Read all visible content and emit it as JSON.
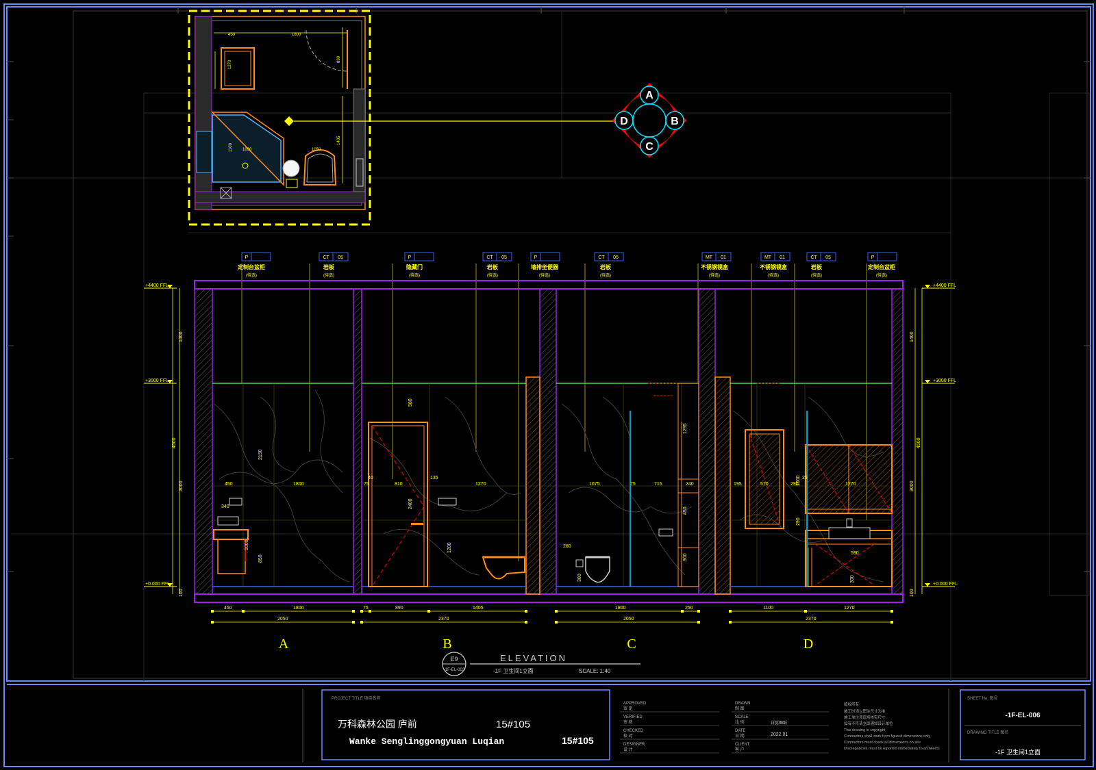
{
  "plan": {
    "dims": [
      "450",
      "1800",
      "1270",
      "890",
      "1100",
      "1000",
      "1050",
      "1405"
    ],
    "index_marks": [
      "A",
      "B",
      "C",
      "D"
    ]
  },
  "tags": [
    {
      "code": "P",
      "num": "",
      "label": "定制台盆柜",
      "sub": "(待选)"
    },
    {
      "code": "CT",
      "num": "05",
      "label": "岩板",
      "sub": "(待选)"
    },
    {
      "code": "P",
      "num": "",
      "label": "隐藏门",
      "sub": "(待选)"
    },
    {
      "code": "CT",
      "num": "05",
      "label": "岩板",
      "sub": "(待选)"
    },
    {
      "code": "P",
      "num": "",
      "label": "墙排坐便器",
      "sub": "(待选)"
    },
    {
      "code": "CT",
      "num": "05",
      "label": "岩板",
      "sub": "(待选)"
    },
    {
      "code": "MT",
      "num": "01",
      "label": "不锈钢镜盒",
      "sub": "(待选)"
    },
    {
      "code": "MT",
      "num": "01",
      "label": "不锈钢镜盒",
      "sub": "(待选)"
    },
    {
      "code": "CT",
      "num": "05",
      "label": "岩板",
      "sub": "(待选)"
    },
    {
      "code": "P",
      "num": "",
      "label": "定制台盆柜",
      "sub": "(待选)"
    }
  ],
  "levels": {
    "top": "+4400 FFL",
    "mid": "+3000 FFL",
    "bottom": "+0.000 FFL"
  },
  "vertical_dims": [
    "1400",
    "4500",
    "3000",
    "100"
  ],
  "inner_dims": {
    "a": [
      "450",
      "1800",
      "340",
      "2150",
      "1000",
      "850"
    ],
    "b": [
      "75",
      "40",
      "810",
      "135",
      "1270",
      "580",
      "2400",
      "1200"
    ],
    "c": [
      "1075",
      "75",
      "715",
      "240",
      "1295",
      "450",
      "900",
      "260",
      "300"
    ],
    "d": [
      "195",
      "570",
      "290",
      "1270",
      "25",
      "1000",
      "290",
      "300",
      "590"
    ]
  },
  "bottom_dims": {
    "a": [
      "450",
      "1800",
      "2050"
    ],
    "b": [
      "75",
      "890",
      "1405",
      "2370"
    ],
    "c": [
      "1800",
      "250",
      "2050"
    ],
    "d": [
      "1100",
      "1270",
      "2370"
    ]
  },
  "elevation_letters": [
    "A",
    "B",
    "C",
    "D"
  ],
  "drawing_title": {
    "tag_top": "E9",
    "tag_bottom": "-1F-EL-003",
    "main": "ELEVATION",
    "sub": "-1F  卫生间1立面",
    "scale": "SCALE: 1:40"
  },
  "title_block": {
    "project_label": "PROJECT TITLE   项目名称",
    "project_cn": "万科森林公园 庐前",
    "project_code_cn": "15#105",
    "project_en": "Wanke Senglinggongyuan Luqian",
    "project_code_en": "15#105",
    "roles_left": [
      [
        "APPROVED",
        "审 定"
      ],
      [
        "VERIFIED",
        "审 核"
      ],
      [
        "CHECKED",
        "校 对"
      ],
      [
        "DESIGNER",
        "设 计"
      ]
    ],
    "roles_right": [
      [
        "DRAWN",
        "制 图"
      ],
      [
        "SCALE",
        "比 例"
      ],
      [
        "DATE",
        "日 期"
      ],
      [
        "CLIENT",
        "客 户"
      ]
    ],
    "scale_value": "详见图纸",
    "date_value": "2022.01",
    "notes": [
      "版权所有",
      "施工时须以图注尺寸为准",
      "施工单位须现场核实尺寸",
      "如有不符请立即通知设计单位",
      "This drawing is copyright",
      "Contractors shall work from figured dimensions only",
      "Contractors must check all dimensions on site",
      "Discrepancies must be reported immediately to architects"
    ],
    "sheet_no_label": "SHEET No.   图号",
    "sheet_no": "-1F-EL-006",
    "drawing_title_label": "DRAWING TITLE   图名",
    "drawing_title_value": "-1F  卫生间1立面"
  },
  "colors": {
    "yellow": "#ffff00",
    "purple": "#a020f0",
    "orange": "#ff8c1a",
    "red": "#ff0000",
    "cyan": "#00e5ff",
    "blue": "#3a5fff",
    "green": "#55ff55",
    "gray": "#555555"
  }
}
